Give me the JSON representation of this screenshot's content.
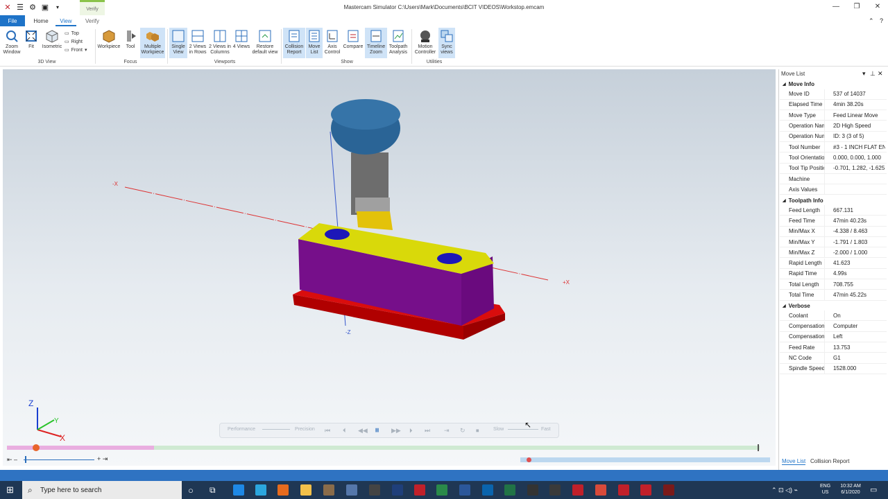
{
  "window": {
    "title": "Mastercam Simulator  C:\\Users\\Mark\\Documents\\BCIT VIDEOS\\Workstop.emcam",
    "context_tab": "Verify"
  },
  "tabs": [
    "File",
    "Home",
    "View",
    "Verify"
  ],
  "ribbon": {
    "view3d": {
      "label": "3D View",
      "zoom_window": "Zoom Window",
      "fit": "Fit",
      "isometric": "Isometric",
      "top": "Top",
      "right": "Right",
      "front": "Front"
    },
    "focus": {
      "label": "Focus",
      "workpiece": "Workpiece",
      "tool": "Tool",
      "multiple_workpiece": "Multiple Workpiece"
    },
    "viewports": {
      "label": "Viewports",
      "single": "Single View",
      "rows": "2 Views in Rows",
      "columns": "2 Views in Columns",
      "four": "4 Views",
      "restore": "Restore default view"
    },
    "show": {
      "label": "Show",
      "collision": "Collision Report",
      "move_list": "Move List",
      "axis": "Axis Control",
      "compare": "Compare",
      "timeline": "Timeline Zoom",
      "toolpath": "Toolpath Analysis"
    },
    "utilities": {
      "label": "Utilities",
      "motion": "Motion Controller",
      "sync": "Sync views"
    }
  },
  "panel": {
    "title": "Move List",
    "sections": [
      {
        "name": "Move Info",
        "rows": [
          [
            "Move ID",
            "537 of 14037"
          ],
          [
            "Elapsed Time",
            "4min 38.20s"
          ],
          [
            "Move Type",
            "Feed Linear Move"
          ],
          [
            "Operation Name",
            "2D High Speed"
          ],
          [
            "Operation Numb",
            "ID: 3 (3 of 5)"
          ],
          [
            "Tool Number",
            "#3 - 1 INCH FLAT EN"
          ],
          [
            "Tool Orientation",
            "0.000, 0.000, 1.000"
          ],
          [
            "Tool Tip Position",
            "-0.701, 1.282, -1.625"
          ],
          [
            "Machine",
            ""
          ],
          [
            "Axis Values",
            ""
          ]
        ]
      },
      {
        "name": "Toolpath Info",
        "rows": [
          [
            "Feed Length",
            "667.131"
          ],
          [
            "Feed Time",
            "47min 40.23s"
          ],
          [
            "Min/Max X",
            "-4.338 / 8.463"
          ],
          [
            "Min/Max Y",
            "-1.791 / 1.803"
          ],
          [
            "Min/Max Z",
            "-2.000 / 1.000"
          ],
          [
            "Rapid Length",
            "41.623"
          ],
          [
            "Rapid Time",
            "4.99s"
          ],
          [
            "Total Length",
            "708.755"
          ],
          [
            "Total Time",
            "47min 45.22s"
          ]
        ]
      },
      {
        "name": "Verbose",
        "rows": [
          [
            "Coolant",
            "On"
          ],
          [
            "Compensation T",
            "Computer"
          ],
          [
            "Compensation D",
            "Left"
          ],
          [
            "Feed Rate",
            "13.753"
          ],
          [
            "NC Code",
            "G1"
          ],
          [
            "Spindle Speed",
            "1528.000"
          ]
        ]
      }
    ],
    "bottom_tabs": [
      "Move List",
      "Collision Report"
    ]
  },
  "playback": {
    "performance": "Performance",
    "precision": "Precision",
    "slow": "Slow",
    "fast": "Fast"
  },
  "axes": {
    "x": "X",
    "y": "Y",
    "z": "Z"
  },
  "axis_labels": {
    "plus_x": "+X",
    "minus_x": "-X",
    "minus_z": "-Z"
  },
  "taskbar": {
    "search_placeholder": "Type here to search",
    "lang": "ENG",
    "region": "US",
    "time": "10:32 AM",
    "date": "6/1/2020"
  }
}
